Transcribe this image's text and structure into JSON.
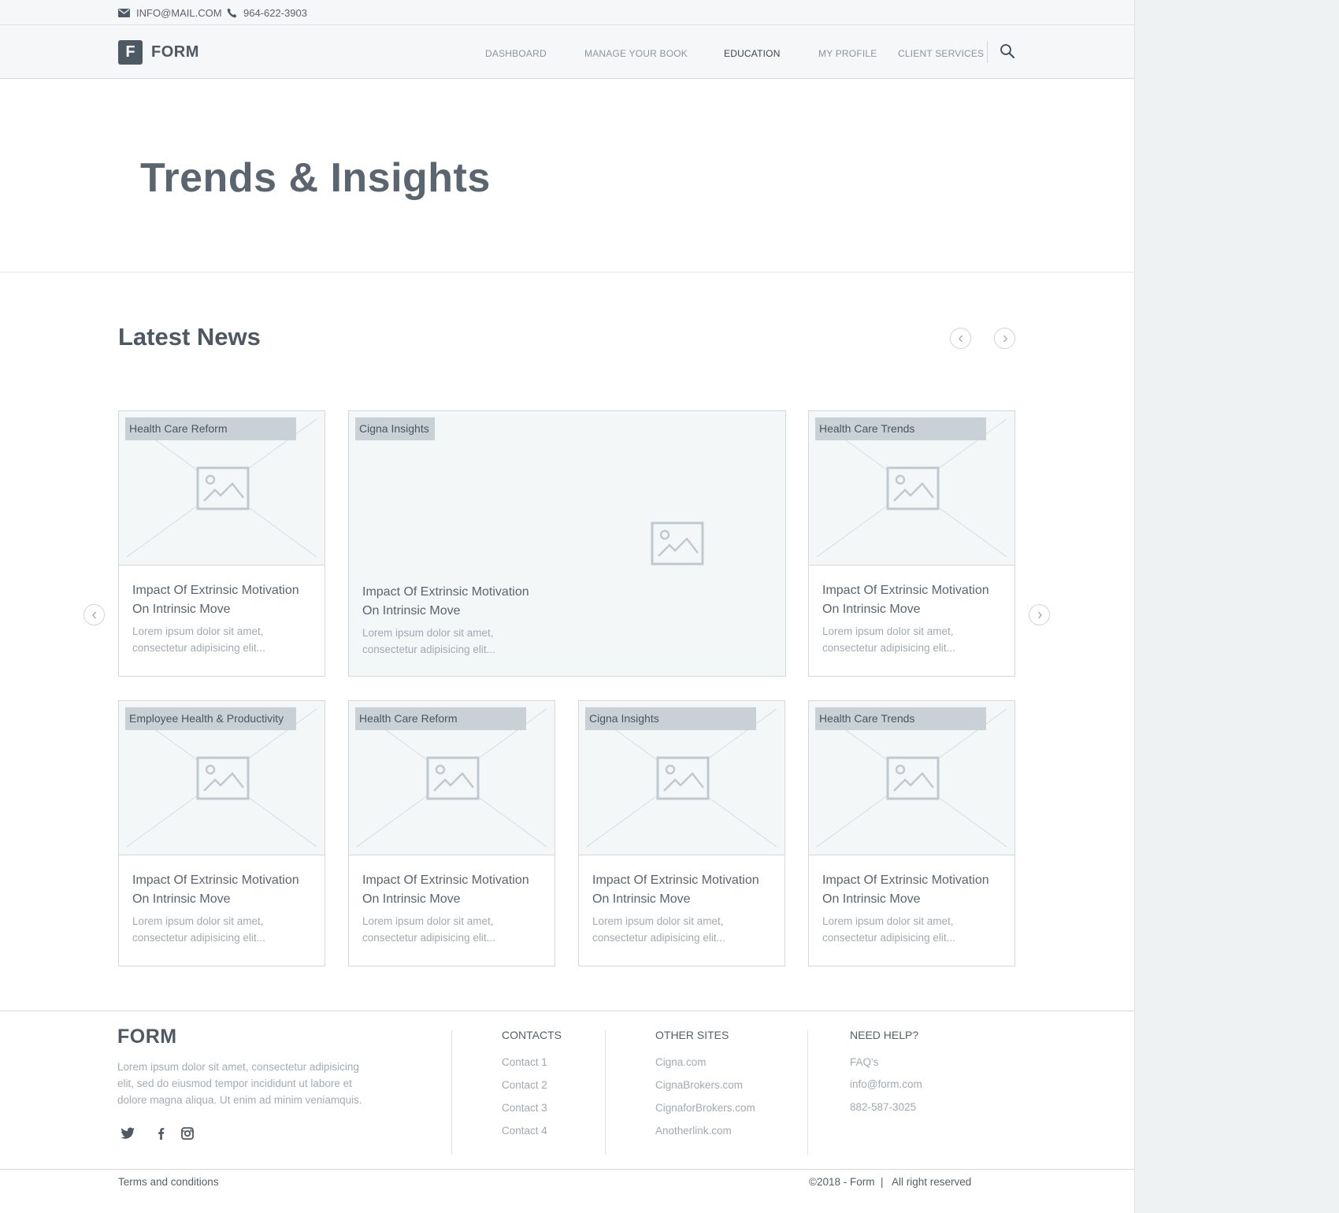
{
  "topbar": {
    "email": "INFO@MAIL.COM",
    "phone": "964-622-3903"
  },
  "brand": {
    "initial": "F",
    "name": "FORM"
  },
  "nav": [
    {
      "label": "DASHBOARD",
      "active": false
    },
    {
      "label": "MANAGE YOUR BOOK",
      "active": false
    },
    {
      "label": "EDUCATION",
      "active": true
    },
    {
      "label": "MY PROFILE",
      "active": false
    },
    {
      "label": "CLIENT SERVICES",
      "active": false
    }
  ],
  "hero": {
    "title": "Trends & Insights"
  },
  "news": {
    "title": "Latest News",
    "cards": [
      {
        "tag": "Health Care Reform",
        "title_line1": "Impact Of Extrinsic Motivation",
        "title_line2": "On Intrinsic Move",
        "desc_line1": "Lorem ipsum dolor sit amet,",
        "desc_line2": "consectetur adipisicing elit..."
      },
      {
        "tag": "Cigna Insights",
        "title_line1": "Impact Of Extrinsic Motivation",
        "title_line2": "On Intrinsic Move",
        "desc_line1": "Lorem ipsum dolor sit amet,",
        "desc_line2": "consectetur adipisicing elit..."
      },
      {
        "tag": "Health Care Trends",
        "title_line1": "Impact Of Extrinsic Motivation",
        "title_line2": "On Intrinsic Move",
        "desc_line1": "Lorem ipsum dolor sit amet,",
        "desc_line2": "consectetur adipisicing elit..."
      },
      {
        "tag": "Employee Health & Productivity",
        "title_line1": "Impact Of Extrinsic Motivation",
        "title_line2": "On Intrinsic Move",
        "desc_line1": "Lorem ipsum dolor sit amet,",
        "desc_line2": "consectetur adipisicing elit..."
      },
      {
        "tag": "Health Care Reform",
        "title_line1": "Impact Of Extrinsic Motivation",
        "title_line2": "On Intrinsic Move",
        "desc_line1": "Lorem ipsum dolor sit amet,",
        "desc_line2": "consectetur adipisicing elit..."
      },
      {
        "tag": "Cigna Insights",
        "title_line1": "Impact Of Extrinsic Motivation",
        "title_line2": "On Intrinsic Move",
        "desc_line1": "Lorem ipsum dolor sit amet,",
        "desc_line2": "consectetur adipisicing elit..."
      },
      {
        "tag": "Health Care Trends",
        "title_line1": "Impact Of Extrinsic Motivation",
        "title_line2": "On Intrinsic Move",
        "desc_line1": "Lorem ipsum dolor sit amet,",
        "desc_line2": "consectetur adipisicing elit..."
      }
    ]
  },
  "footer": {
    "logo": "FORM",
    "about_line1": "Lorem ipsum dolor sit amet, consectetur adipisicing",
    "about_line2": "elit, sed do eiusmod tempor incididunt ut labore et",
    "about_line3": "dolore magna aliqua. Ut enim ad minim veniamquis.",
    "contacts": {
      "heading": "CONTACTS",
      "links": [
        "Contact 1",
        "Contact 2",
        "Contact 3",
        "Contact 4"
      ]
    },
    "other_sites": {
      "heading": "OTHER SITES",
      "links": [
        "Cigna.com",
        "CignaBrokers.com",
        "CignaforBrokers.com",
        "Anotherlink.com"
      ]
    },
    "need_help": {
      "heading": "NEED HELP?",
      "links": [
        "FAQ's",
        "info@form.com",
        "882-587-3025"
      ]
    },
    "terms": "Terms and conditions",
    "copyright": "©2018 - Form  |   All right reserved"
  },
  "icons": {
    "email": "envelope-icon",
    "phone": "phone-icon",
    "search": "search-icon",
    "prev": "chevron-left-icon",
    "next": "chevron-right-icon",
    "twitter": "twitter-icon",
    "facebook": "facebook-icon",
    "instagram": "instagram-icon",
    "image": "image-placeholder-icon"
  },
  "colors": {
    "primary": "#4d5964",
    "tag_bg": "#c9d1d7",
    "muted_text": "#a1a9b0",
    "border": "#d2d8dc"
  }
}
